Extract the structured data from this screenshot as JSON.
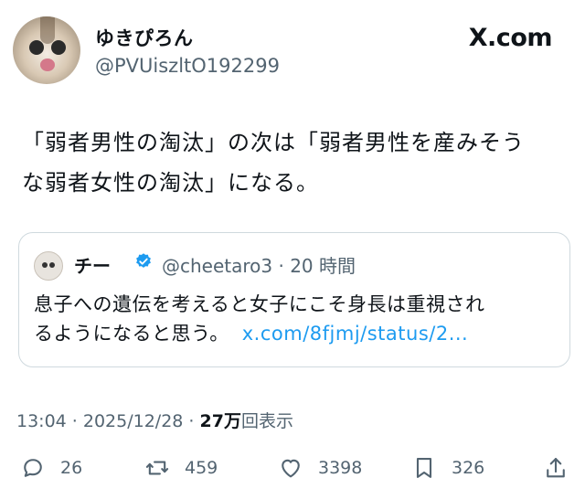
{
  "author": {
    "display_name": "ゆきぴろん",
    "handle": "@PVUiszltO192299",
    "avatar_icon": "cat-avatar-icon"
  },
  "brand": "X.com",
  "tweet": {
    "text": "「弱者男性の淘汰」の次は「弱者男性を産みそう\nな弱者女性の淘汰」になる。"
  },
  "quote": {
    "display_name": "チー",
    "verified": true,
    "meta": "@cheetaro3 · 20 時間",
    "text": "息子への遺伝を考えると女子にこそ身長は重視され\nるようになると思う。",
    "link": "x.com/8fjmj/status/2..."
  },
  "timestamp": {
    "time_date": "13:04 · 2025/12/28 ·",
    "views_count": "27万",
    "views_label": "回表示"
  },
  "actions": {
    "reply_count": "26",
    "repost_count": "459",
    "like_count": "3398",
    "bookmark_count": "326"
  },
  "colors": {
    "text": "#0f1419",
    "secondary": "#536471",
    "link": "#1d9bf0",
    "verified": "#1d9bf0",
    "border": "#cfd9de"
  }
}
